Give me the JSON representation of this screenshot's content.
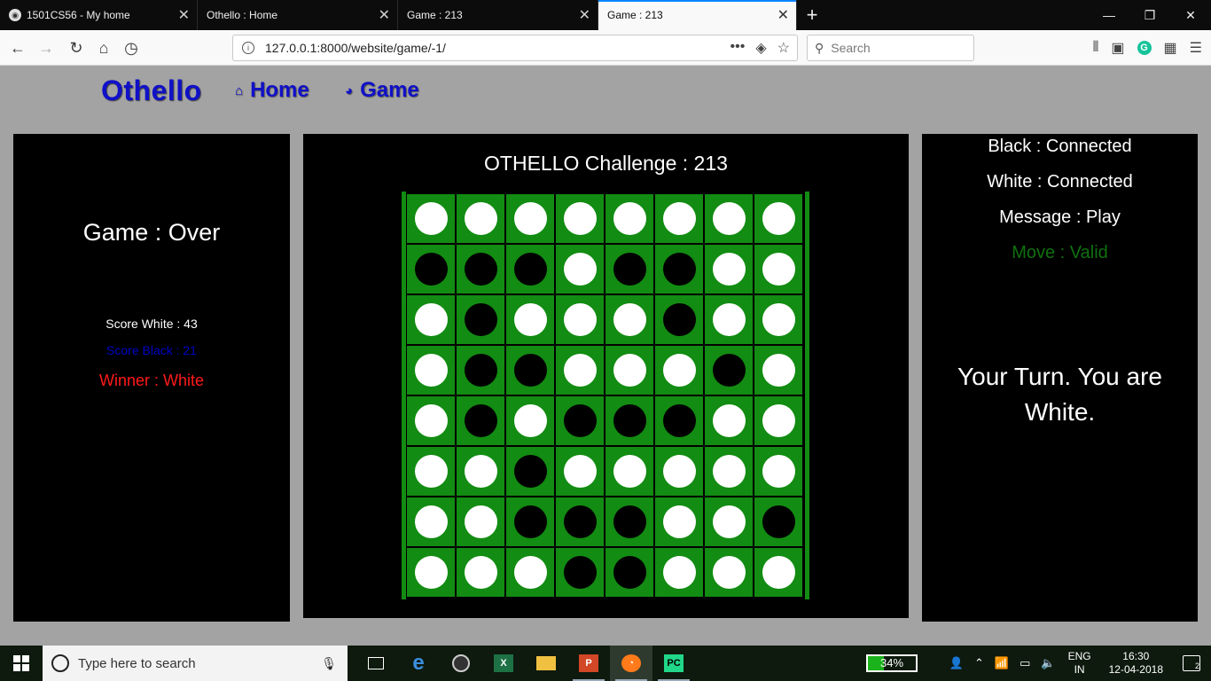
{
  "browser": {
    "tabs": [
      {
        "title": "1501CS56 - My home",
        "active": false
      },
      {
        "title": "Othello : Home",
        "active": false
      },
      {
        "title": "Game : 213",
        "active": false
      },
      {
        "title": "Game : 213",
        "active": true
      }
    ],
    "url": "127.0.0.1:8000/website/game/-1/",
    "search_placeholder": "Search"
  },
  "site": {
    "brand": "Othello",
    "nav": [
      {
        "label": "Home",
        "icon": "home-icon"
      },
      {
        "label": "Game",
        "icon": "globe-icon"
      }
    ]
  },
  "left_panel": {
    "game_status": "Game : Over",
    "score_white": "Score White : 43",
    "score_black": "Score Black : 21",
    "winner": "Winner : White"
  },
  "center_panel": {
    "title": "OTHELLO Challenge : 213",
    "board": [
      [
        "W",
        "W",
        "W",
        "W",
        "W",
        "W",
        "W",
        "W"
      ],
      [
        "B",
        "B",
        "B",
        "W",
        "B",
        "B",
        "W",
        "W"
      ],
      [
        "W",
        "B",
        "W",
        "W",
        "W",
        "B",
        "W",
        "W"
      ],
      [
        "W",
        "B",
        "B",
        "W",
        "W",
        "W",
        "B",
        "W"
      ],
      [
        "W",
        "B",
        "W",
        "B",
        "B",
        "B",
        "W",
        "W"
      ],
      [
        "W",
        "W",
        "B",
        "W",
        "W",
        "W",
        "W",
        "W"
      ],
      [
        "W",
        "W",
        "B",
        "B",
        "B",
        "W",
        "W",
        "B"
      ],
      [
        "W",
        "W",
        "W",
        "B",
        "B",
        "W",
        "W",
        "W"
      ]
    ]
  },
  "right_panel": {
    "black_status": "Black : Connected",
    "white_status": "White : Connected",
    "message": "Message : Play",
    "move": "Move : Valid",
    "turn_line1": "Your Turn. You are",
    "turn_line2": "White."
  },
  "taskbar": {
    "search_placeholder": "Type here to search",
    "battery": "34%",
    "battery_level": 0.34,
    "lang_top": "ENG",
    "lang_bottom": "IN",
    "time": "16:30",
    "date": "12-04-2018",
    "notifications": "2"
  },
  "colors": {
    "board_green": "#128c12",
    "brand_blue": "#1010c8",
    "winner_red": "#ff1a1a",
    "move_green": "#107010"
  }
}
